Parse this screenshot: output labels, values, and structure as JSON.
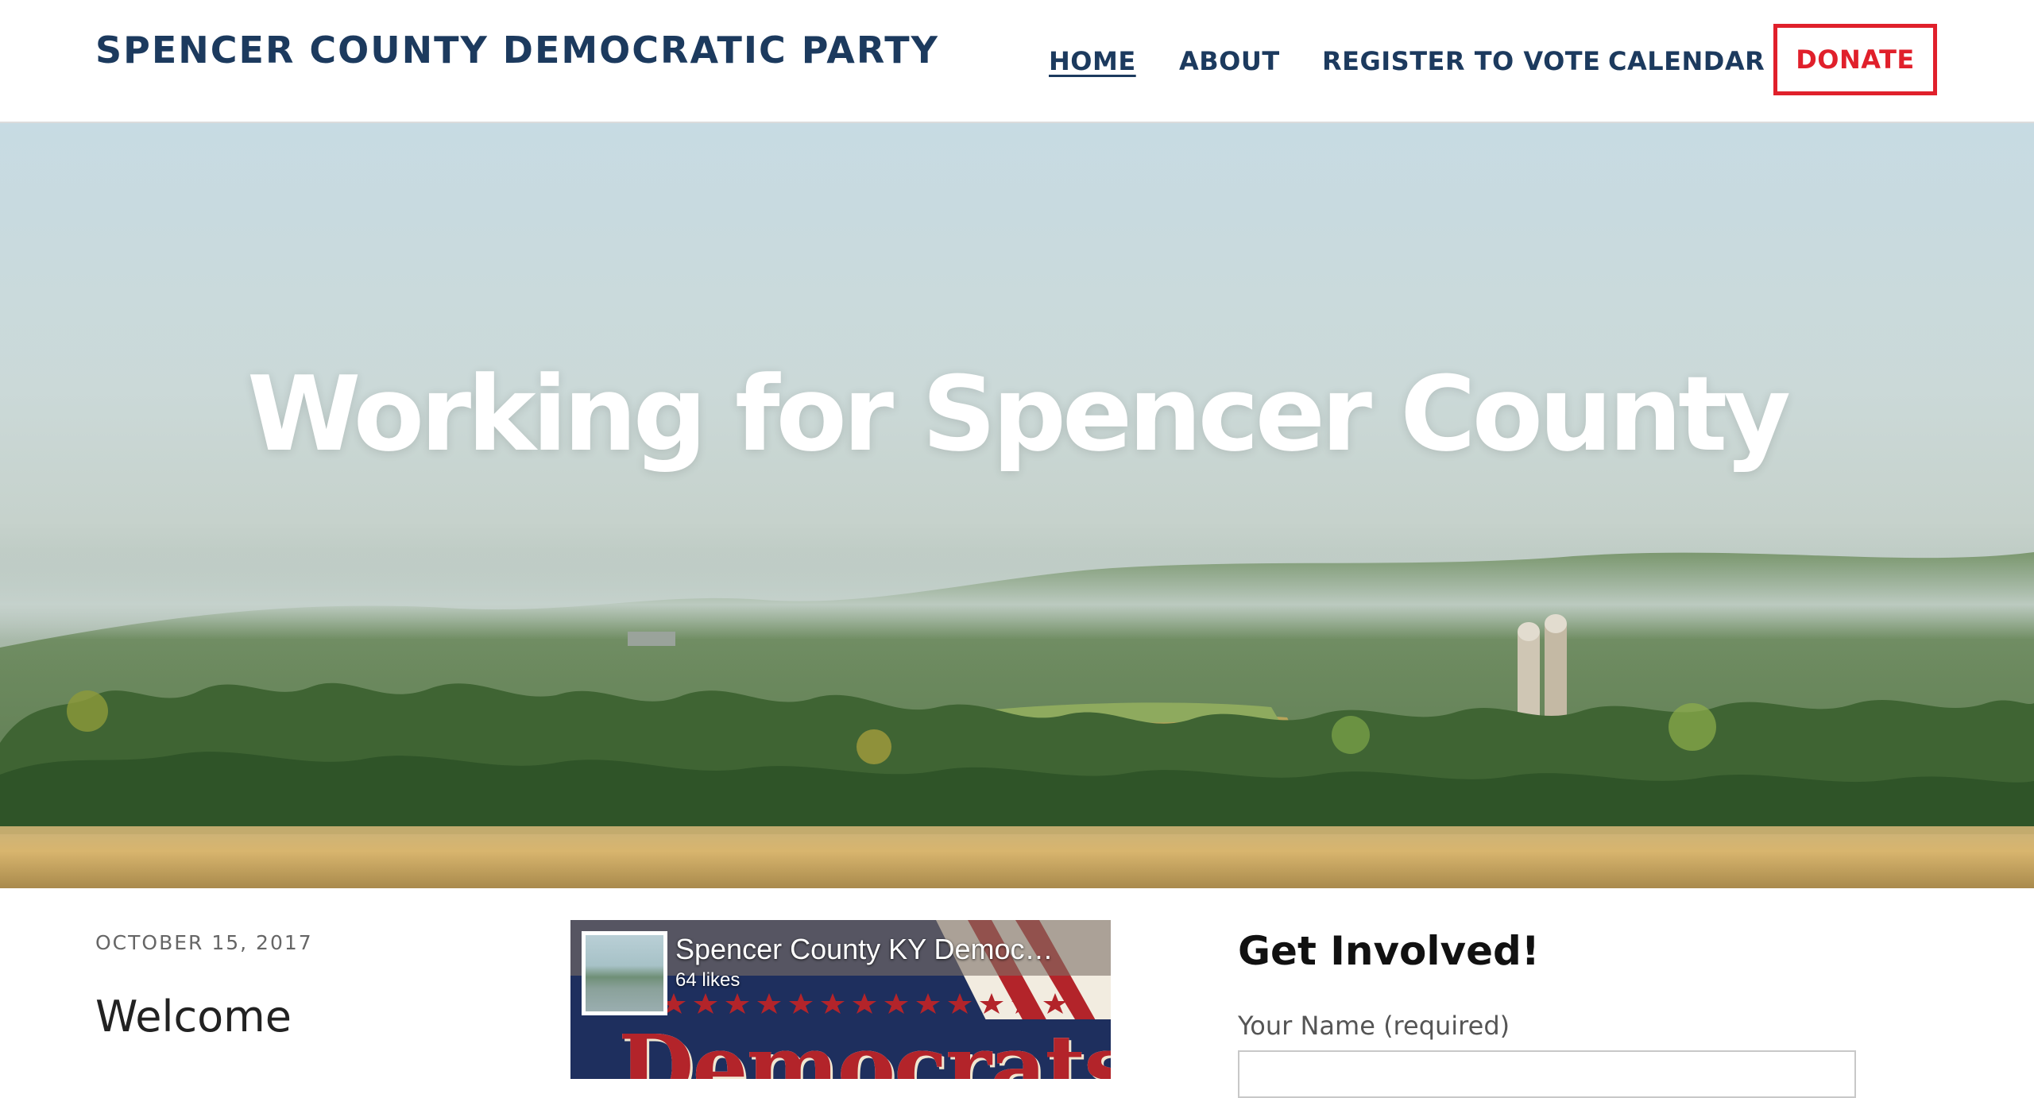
{
  "header": {
    "site_title": "SPENCER COUNTY DEMOCRATIC PARTY",
    "nav": {
      "home": "HOME",
      "about": "ABOUT",
      "register": "REGISTER TO VOTE",
      "calendar": "CALENDAR",
      "donate": "DONATE"
    }
  },
  "hero": {
    "title": "Working for Spencer County"
  },
  "post": {
    "date": "OCTOBER 15, 2017",
    "title": "Welcome"
  },
  "facebook_widget": {
    "page_name": "Spencer County KY Democ…",
    "likes": "64 likes",
    "banner_text": "Democrats"
  },
  "sidebar": {
    "heading": "Get Involved!",
    "name_label": "Your Name (required)"
  },
  "colors": {
    "brand_navy": "#1c3a5e",
    "donate_red": "#e0202b"
  }
}
